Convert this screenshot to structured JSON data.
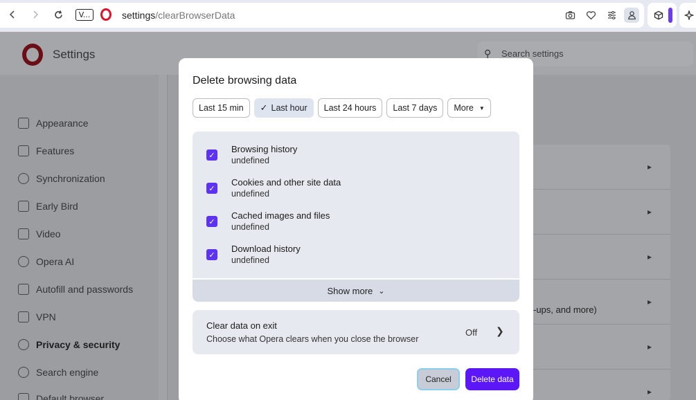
{
  "browser": {
    "back_icon": "arrow-left-icon",
    "forward_icon": "arrow-right-icon",
    "reload_icon": "reload-icon",
    "tab_chip_label": "V...",
    "address_host": "settings",
    "address_path": "/clearBrowserData",
    "accent_color": "#5b17f5",
    "toolbar_icons": [
      "camera-icon",
      "heart-icon",
      "sliders-icon",
      "account-icon",
      "box-icon",
      "sparkle-icon"
    ]
  },
  "settings": {
    "title": "Settings",
    "search_placeholder": "Search settings",
    "sidebar": {
      "items": [
        {
          "label": "Appearance",
          "icon": "image-icon"
        },
        {
          "label": "Features",
          "icon": "list-icon"
        },
        {
          "label": "Synchronization",
          "icon": "sync-icon"
        },
        {
          "label": "Early Bird",
          "icon": "flask-icon"
        },
        {
          "label": "Video",
          "icon": "play-icon"
        },
        {
          "label": "Opera AI",
          "icon": "ai-icon"
        },
        {
          "label": "Autofill and passwords",
          "icon": "key-icon"
        },
        {
          "label": "VPN",
          "icon": "vpn-icon"
        },
        {
          "label": "Privacy & security",
          "icon": "shield-icon",
          "active": true
        },
        {
          "label": "Search engine",
          "icon": "search-icon"
        },
        {
          "label": "Default browser",
          "icon": "browser-icon"
        }
      ]
    },
    "card_fragment_text": "-ups, and more)"
  },
  "modal": {
    "title": "Delete browsing data",
    "time_ranges": [
      {
        "label": "Last 15 min",
        "selected": false
      },
      {
        "label": "Last hour",
        "selected": true
      },
      {
        "label": "Last 24 hours",
        "selected": false
      },
      {
        "label": "Last 7 days",
        "selected": false
      }
    ],
    "more_label": "More",
    "items": [
      {
        "label": "Browsing history",
        "sub": "undefined",
        "checked": true
      },
      {
        "label": "Cookies and other site data",
        "sub": "undefined",
        "checked": true
      },
      {
        "label": "Cached images and files",
        "sub": "undefined",
        "checked": true
      },
      {
        "label": "Download history",
        "sub": "undefined",
        "checked": true
      }
    ],
    "show_more_label": "Show more",
    "clear_on_exit": {
      "title": "Clear data on exit",
      "description": "Choose what Opera clears when you close the browser",
      "status": "Off"
    },
    "cancel_label": "Cancel",
    "delete_label": "Delete data"
  }
}
